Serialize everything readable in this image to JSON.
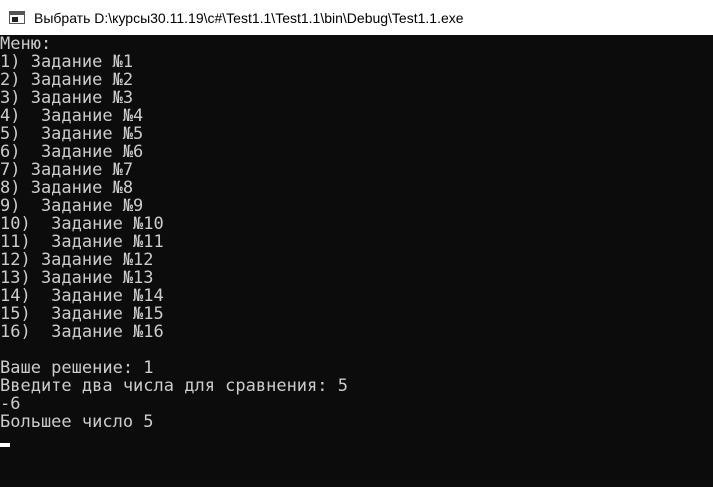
{
  "window": {
    "title": "Выбрать D:\\курсы30.11.19\\с#\\Test1.1\\Test1.1\\bin\\Debug\\Test1.1.exe",
    "icon": "console-app-icon"
  },
  "console": {
    "lines": [
      "Меню:",
      "1) Задание №1",
      "2) Задание №2",
      "3) Задание №3",
      "4)  Задание №4",
      "5)  Задание №5",
      "6)  Задание №6",
      "7) Задание №7",
      "8) Задание №8",
      "9)  Задание №9",
      "10)  Задание №10",
      "11)  Задание №11",
      "12) Задание №12",
      "13) Задание №13",
      "14)  Задание №14",
      "15)  Задание №15",
      "16)  Задание №16",
      "",
      "Ваше решение: 1",
      "Введите два числа для сравнения: 5",
      "-6",
      "Большее число 5"
    ]
  }
}
